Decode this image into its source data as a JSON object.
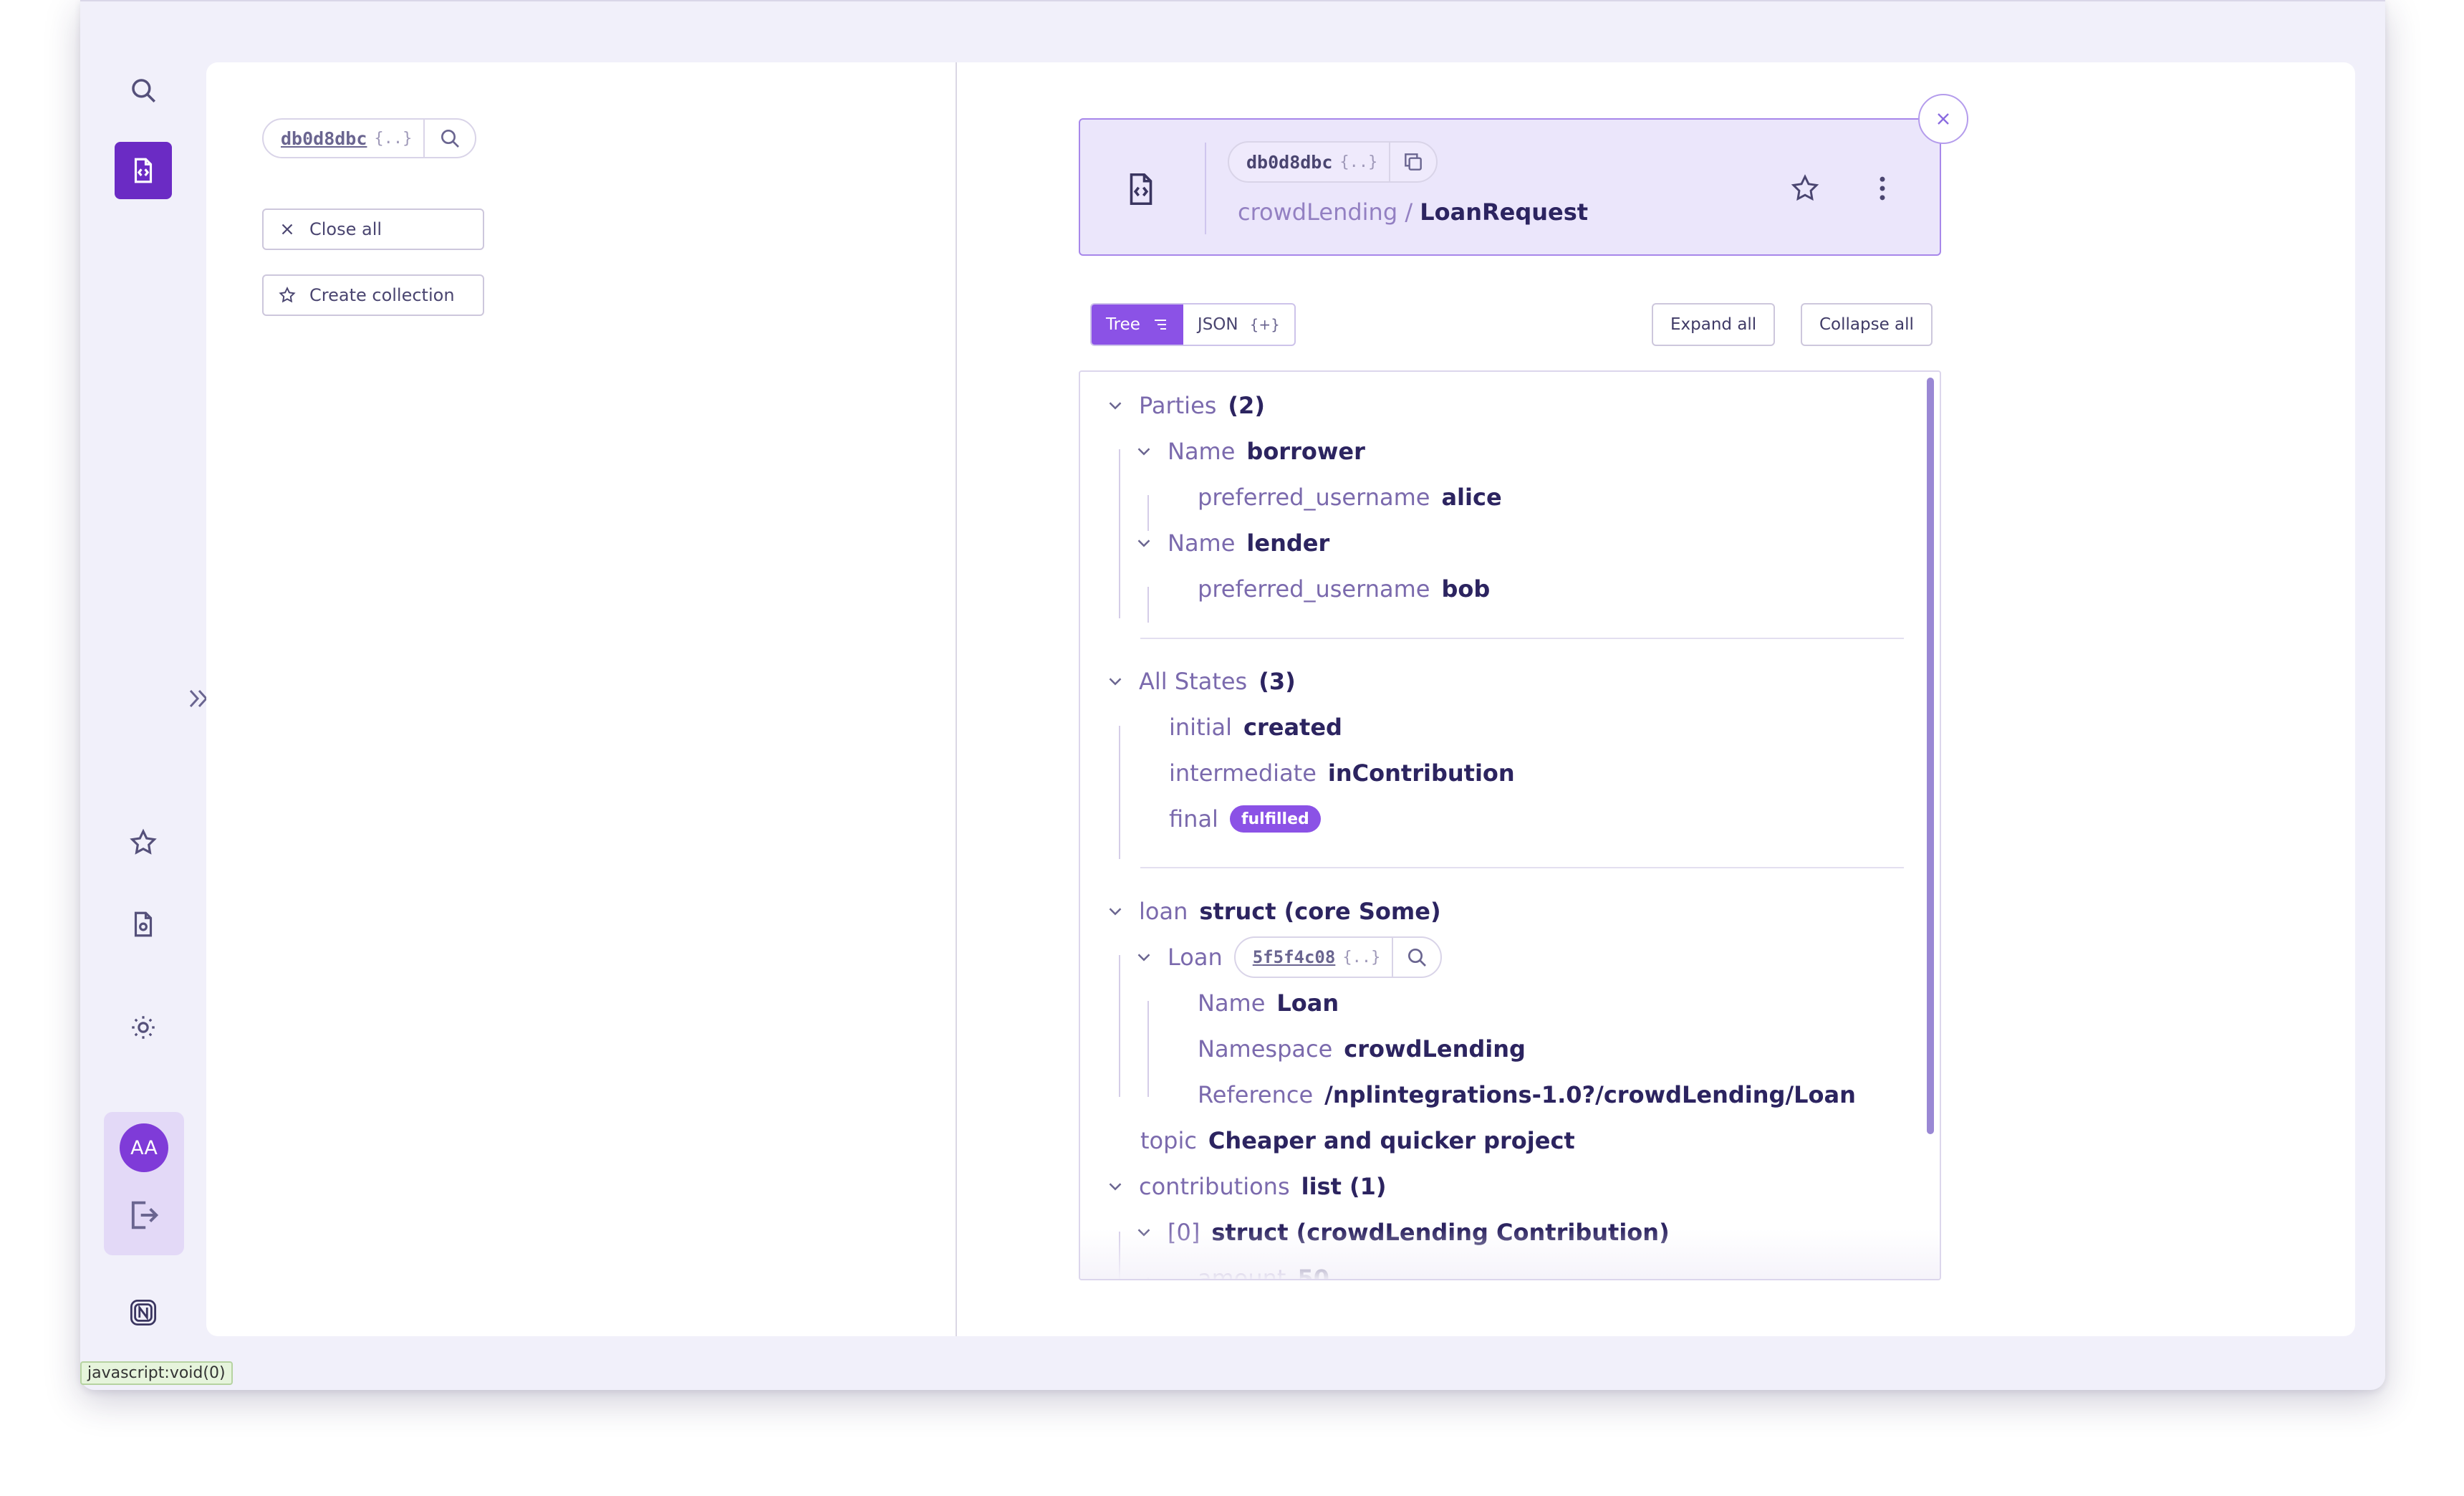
{
  "status_bar": {
    "url": "javascript:void(0)"
  },
  "user": {
    "initials": "AA"
  },
  "left_panel": {
    "chip_id": "db0d8dbc",
    "chip_brace": "{..}",
    "close_all_label": "Close all",
    "create_collection_label": "Create collection"
  },
  "doc": {
    "chip_id": "db0d8dbc",
    "chip_brace": "{..}",
    "namespace": "crowdLending",
    "separator": " / ",
    "type_name": "LoanRequest"
  },
  "view_toggle": {
    "tree_label": "Tree",
    "json_label": "JSON",
    "json_suffix": "{+}"
  },
  "actions": {
    "expand_all": "Expand all",
    "collapse_all": "Collapse all"
  },
  "tree": {
    "parties": {
      "label": "Parties",
      "count": "(2)"
    },
    "borrower": {
      "key": "Name",
      "value": "borrower",
      "sub_key": "preferred_username",
      "sub_value": "alice"
    },
    "lender": {
      "key": "Name",
      "value": "lender",
      "sub_key": "preferred_username",
      "sub_value": "bob"
    },
    "states": {
      "label": "All States",
      "count": "(3)"
    },
    "initial": {
      "key": "initial",
      "value": "created"
    },
    "intermediate": {
      "key": "intermediate",
      "value": "inContribution"
    },
    "final": {
      "key": "final",
      "value": "fulfilled"
    },
    "loan": {
      "key": "loan",
      "value": "struct (core Some)"
    },
    "loan_ref": {
      "key": "Loan",
      "chip_id": "5f5f4c08",
      "chip_brace": "{..}"
    },
    "loan_name": {
      "key": "Name",
      "value": "Loan"
    },
    "loan_namespace": {
      "key": "Namespace",
      "value": "crowdLending"
    },
    "loan_reference": {
      "key": "Reference",
      "value": "/nplintegrations-1.0?/crowdLending/Loan"
    },
    "topic": {
      "key": "topic",
      "value": "Cheaper and quicker project"
    },
    "contributions": {
      "key": "contributions",
      "value": "list (1)"
    },
    "contribution0": {
      "key": "[0]",
      "value": "struct (crowdLending Contribution)"
    },
    "amount": {
      "key": "amount",
      "value": "50"
    }
  },
  "colors": {
    "accent": "#6b2bc4",
    "accent_light": "#8b52e6",
    "panel_bg": "#ebe6fb"
  }
}
